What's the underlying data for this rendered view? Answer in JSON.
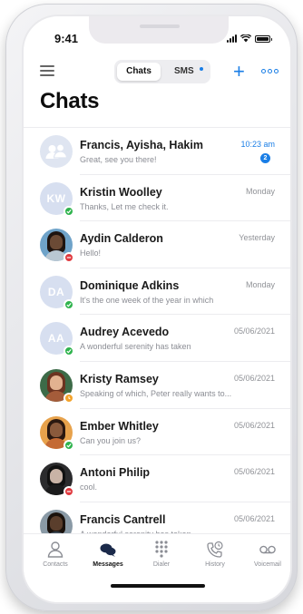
{
  "status_bar": {
    "time": "9:41",
    "signal_icon": "signal-bars-icon",
    "wifi_icon": "wifi-icon",
    "battery_icon": "battery-icon"
  },
  "header": {
    "menu_icon": "hamburger-menu-icon",
    "segments": {
      "chats": "Chats",
      "sms": "SMS"
    },
    "add_icon": "plus-icon",
    "more_icon": "more-options-icon",
    "title": "Chats"
  },
  "colors": {
    "accent": "#1a7ee6",
    "online": "#2fb34d",
    "busy": "#e0393e",
    "away": "#f3a32b"
  },
  "chats": [
    {
      "name": "Francis, Ayisha, Hakim",
      "preview": "Great, see you there!",
      "date": "10:23 am",
      "unread": "2",
      "avatar": {
        "type": "group"
      }
    },
    {
      "name": "Kristin Woolley",
      "preview": "Thanks, Let me check it.",
      "date": "Monday",
      "avatar": {
        "type": "initials",
        "initials": "KW"
      },
      "presence": "online"
    },
    {
      "name": "Aydin Calderon",
      "preview": "Hello!",
      "date": "Yesterday",
      "avatar": {
        "type": "photo",
        "bg": "#6fa3c9",
        "skin": "#6b4a35",
        "hair": "#1e1410",
        "shirt": "#b9c7d2"
      },
      "presence": "busy"
    },
    {
      "name": "Dominique Adkins",
      "preview": "It's the one week of the year in which",
      "date": "Monday",
      "avatar": {
        "type": "initials",
        "initials": "DA"
      },
      "presence": "online"
    },
    {
      "name": "Audrey Acevedo",
      "preview": "A wonderful serenity has taken",
      "date": "05/06/2021",
      "avatar": {
        "type": "initials",
        "initials": "AA"
      },
      "presence": "online"
    },
    {
      "name": "Kristy Ramsey",
      "preview": "Speaking of which, Peter really wants to...",
      "date": "05/06/2021",
      "avatar": {
        "type": "photo",
        "bg": "#3d6b48",
        "skin": "#e2b290",
        "hair": "#6b3320",
        "shirt": "#a45c3a"
      },
      "presence": "away"
    },
    {
      "name": "Ember Whitley",
      "preview": "Can you join us?",
      "date": "05/06/2021",
      "avatar": {
        "type": "photo",
        "bg": "#e7a24c",
        "skin": "#8a5a3c",
        "hair": "#2a1810",
        "shirt": "#c46a34"
      },
      "presence": "online"
    },
    {
      "name": "Antoni Philip",
      "preview": "cool.",
      "date": "05/06/2021",
      "avatar": {
        "type": "photo",
        "bg": "#2b2b2d",
        "skin": "#c9b3a6",
        "hair": "#111111",
        "shirt": "#1b1b1c"
      },
      "presence": "busy"
    },
    {
      "name": "Francis Cantrell",
      "preview": "A wonderful serenity has taken",
      "date": "05/06/2021",
      "avatar": {
        "type": "photo",
        "bg": "#8a9aa6",
        "skin": "#5a3e2c",
        "hair": "#1a120d",
        "shirt": "#3e4a56"
      }
    }
  ],
  "tabs": [
    {
      "label": "Contacts",
      "icon": "person-icon",
      "active": false
    },
    {
      "label": "Messages",
      "icon": "chat-bubbles-icon",
      "active": true
    },
    {
      "label": "Dialer",
      "icon": "dialpad-icon",
      "active": false
    },
    {
      "label": "History",
      "icon": "phone-history-icon",
      "active": false
    },
    {
      "label": "Voicemail",
      "icon": "voicemail-icon",
      "active": false
    }
  ]
}
